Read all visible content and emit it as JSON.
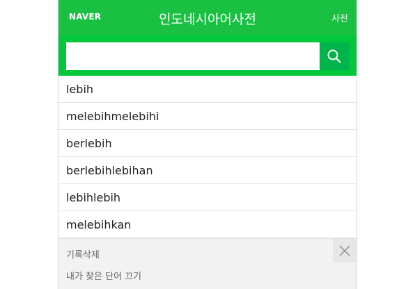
{
  "header": {
    "logo": "NAVER",
    "title": "인도네시아어사전",
    "dict_link": "사전"
  },
  "search": {
    "value": "",
    "placeholder": ""
  },
  "suggestions": [
    "lebih",
    "melebihmelebihi",
    "berlebih",
    "berlebihlebihan",
    "lebihlebih",
    "melebihkan"
  ],
  "footer": {
    "delete_record": "기록삭제",
    "turn_off_my_words": "내가 찾은 단어 끄기"
  },
  "colors": {
    "header_green": "#19c042",
    "search_green": "#00c73c",
    "button_green": "#00b34a"
  },
  "icons": {
    "search": "search-icon",
    "close": "close-icon"
  }
}
